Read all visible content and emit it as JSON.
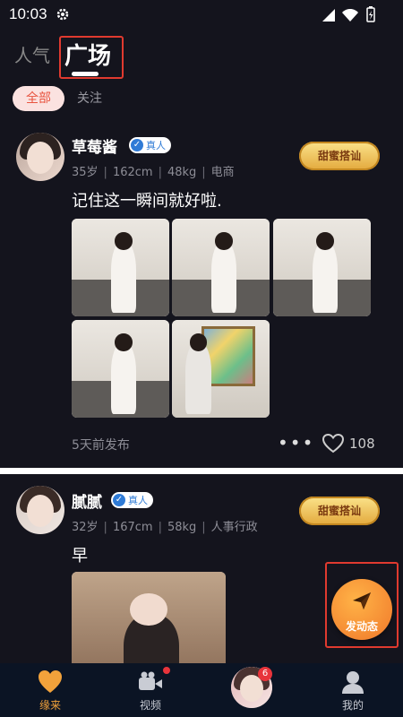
{
  "status_bar": {
    "time": "10:03"
  },
  "tabs": {
    "popular": "人气",
    "square": "广场"
  },
  "filters": {
    "all": "全部",
    "follow": "关注"
  },
  "posts": [
    {
      "name": "草莓酱",
      "verified": "真人",
      "meta": [
        "35岁",
        "162cm",
        "48kg",
        "电商"
      ],
      "greet": "甜蜜搭讪",
      "text": "记住这一瞬间就好啦.",
      "time": "5天前发布",
      "likes": "108"
    },
    {
      "name": "腻腻",
      "verified": "真人",
      "meta": [
        "32岁",
        "167cm",
        "58kg",
        "人事行政"
      ],
      "greet": "甜蜜搭讪",
      "text": "早"
    }
  ],
  "fab": {
    "label": "发动态"
  },
  "nav": [
    {
      "label": "缘来",
      "icon": "heart-icon"
    },
    {
      "label": "视频",
      "icon": "video-icon"
    },
    {
      "label": "",
      "icon": "avatar",
      "badge": "6"
    },
    {
      "label": "我的",
      "icon": "profile-icon"
    }
  ],
  "colors": {
    "accent": "#e8543f",
    "highlight": "#e03a2f",
    "nav_active": "#f2a23b",
    "background": "#14141d"
  }
}
